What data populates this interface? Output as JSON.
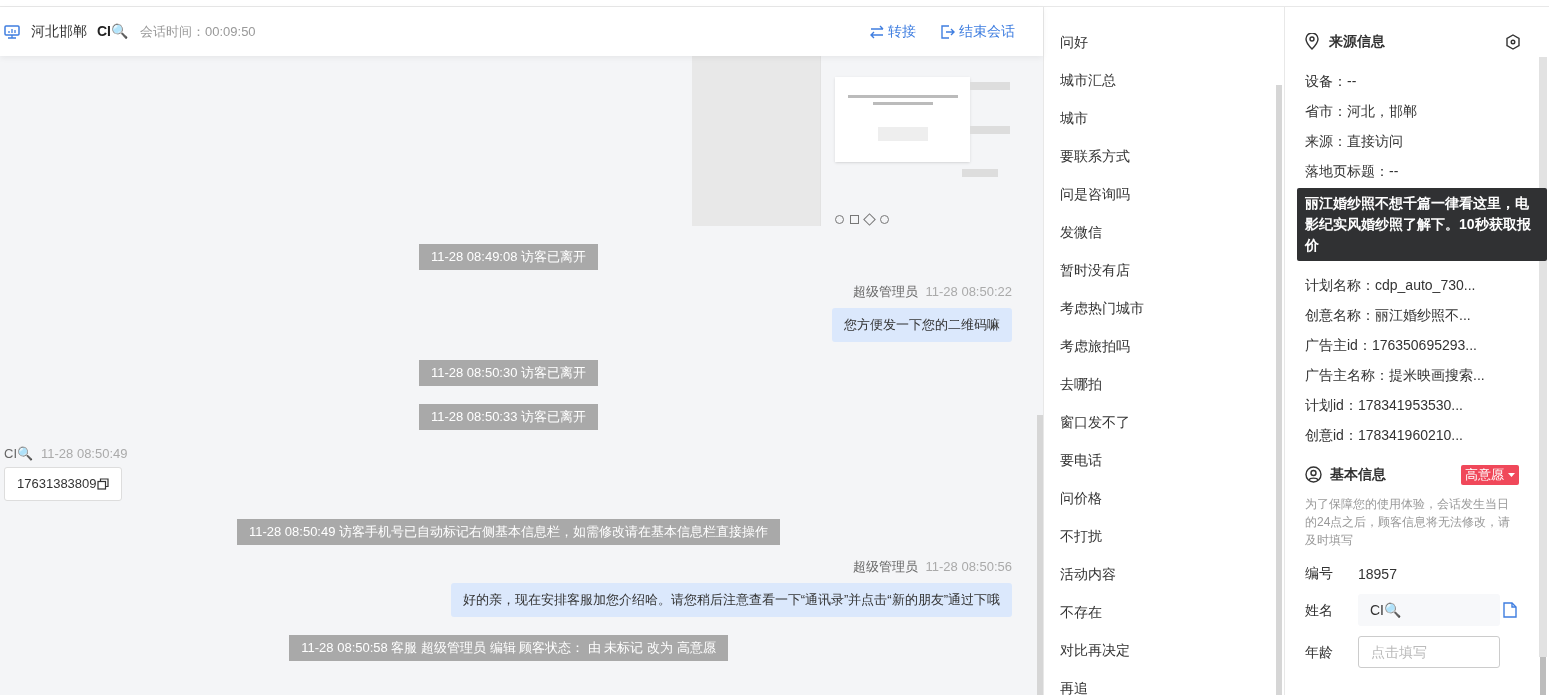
{
  "header": {
    "location": "河北邯郸",
    "visitor": "CI🔍",
    "session_label": "会话时间：",
    "session_time": "00:09:50",
    "actions": [
      {
        "kind": "transfer",
        "label": "转接"
      },
      {
        "kind": "end",
        "label": "结束会话"
      }
    ]
  },
  "messages": [
    {
      "kind": "image"
    },
    {
      "kind": "system",
      "text": "11-28 08:49:08 访客已离开"
    },
    {
      "kind": "agent",
      "sender": "超级管理员",
      "time": "11-28 08:50:22",
      "text": "您方便发一下您的二维码嘛"
    },
    {
      "kind": "system",
      "text": "11-28 08:50:30 访客已离开"
    },
    {
      "kind": "system",
      "text": "11-28 08:50:33 访客已离开"
    },
    {
      "kind": "visitor",
      "sender": "CI🔍",
      "time": "11-28 08:50:49",
      "text": "17631383809"
    },
    {
      "kind": "system",
      "text": "11-28 08:50:49 访客手机号已自动标记右侧基本信息栏，如需修改请在基本信息栏直接操作"
    },
    {
      "kind": "agent",
      "sender": "超级管理员",
      "time": "11-28 08:50:56",
      "text": "好的亲，现在安排客服加您介绍哈。请您稍后注意查看一下“通讯录”并点击“新的朋友”通过下哦"
    },
    {
      "kind": "system",
      "text": "11-28 08:50:58 客服 超级管理员 编辑 顾客状态： 由 未标记 改为 高意愿"
    }
  ],
  "quick_replies": [
    "问好",
    "城市汇总",
    "城市",
    "要联系方式",
    "问是咨询吗",
    "发微信",
    "暂时没有店",
    "考虑热门城市",
    "考虑旅拍吗",
    "去哪拍",
    "窗口发不了",
    "要电话",
    "问价格",
    "不打扰",
    "活动内容",
    "不存在",
    "对比再决定",
    "再追"
  ],
  "source_info": {
    "title": "来源信息",
    "fields": [
      "设备：--",
      "省市：河北，邯郸",
      "来源：直接访问",
      "落地页标题：--",
      "计划名称：cdp_auto_730...",
      "创意名称：丽江婚纱照不...",
      "广告主id：176350695293...",
      "广告主名称：提米映画搜索...",
      "计划id：178341953530...",
      "创意id：178341960210..."
    ],
    "tooltip": "丽江婚纱照不想千篇一律看这里，电影纪实风婚纱照了解下。10秒获取报价"
  },
  "basic_info": {
    "title": "基本信息",
    "tag": "高意愿",
    "note": "为了保障您的使用体验，会话发生当日的24点之后，顾客信息将无法修改，请及时填写",
    "fields": [
      {
        "kind": "text",
        "label": "编号",
        "value": "18957"
      },
      {
        "kind": "input",
        "label": "姓名",
        "value": "CI🔍"
      },
      {
        "kind": "input",
        "label": "年龄",
        "placeholder": "点击填写"
      }
    ]
  }
}
